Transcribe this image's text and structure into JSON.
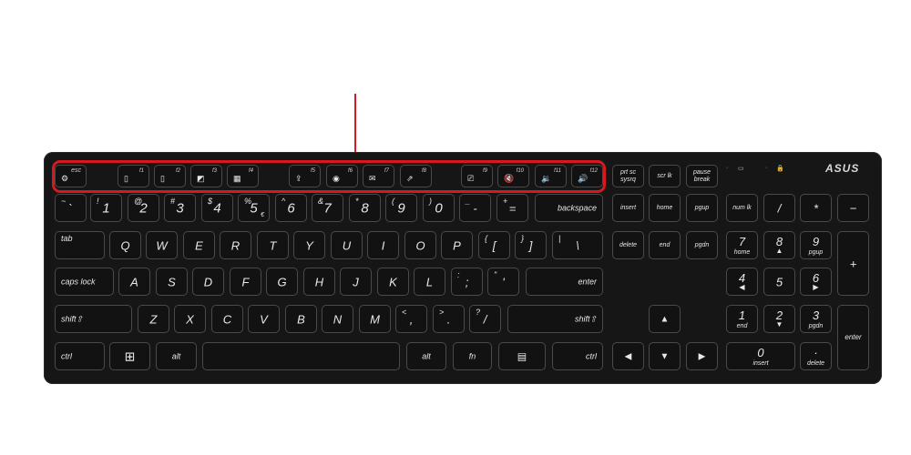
{
  "brand": {
    "logo_text": "ASUS"
  },
  "colors": {
    "highlight": "#d6191f",
    "keyboard": "#161616"
  },
  "indicators": {
    "num_led": "·",
    "battery_icon": "▭",
    "caps_led": "·",
    "lock_icon": "🔒"
  },
  "keys": {
    "esc": "esc",
    "f1": "f1",
    "f2": "f2",
    "f3": "f3",
    "f4": "f4",
    "f5": "f5",
    "f6": "f6",
    "f7": "f7",
    "f8": "f8",
    "f9": "f9",
    "f10": "f10",
    "f11": "f11",
    "f12": "f12",
    "prtsc_top": "prt sc",
    "prtsc_bottom": "sysrq",
    "scrlk": "scr lk",
    "pause_top": "pause",
    "pause_bottom": "break",
    "tilde_top": "~",
    "tilde_main": "`",
    "n1_top": "!",
    "n1": "1",
    "n2_top": "@",
    "n2": "2",
    "n3_top": "#",
    "n3": "3",
    "n4_top": "$",
    "n4": "4",
    "n4_sub": "",
    "n5_top": "%",
    "n5": "5",
    "n5_sub": "€",
    "n6_top": "^",
    "n6": "6",
    "n7_top": "&",
    "n7": "7",
    "n8_top": "*",
    "n8": "8",
    "n9_top": "(",
    "n9": "9",
    "n0_top": ")",
    "n0": "0",
    "minus_top": "_",
    "minus": "-",
    "equals_top": "+",
    "equals": "=",
    "backspace": "backspace",
    "insert": "insert",
    "home": "home",
    "pgup": "pgup",
    "numlk": "num lk",
    "np_div": "/",
    "np_mul": "*",
    "np_sub": "−",
    "tab": "tab",
    "q": "Q",
    "w": "W",
    "e": "E",
    "r": "R",
    "t": "T",
    "y": "Y",
    "u": "U",
    "i": "I",
    "o": "O",
    "p": "P",
    "lbr_top": "{",
    "lbr": "[",
    "rbr_top": "}",
    "rbr": "]",
    "bsl_top": "|",
    "bsl": "\\",
    "delete": "delete",
    "end": "end",
    "pgdn": "pgdn",
    "np7": "7",
    "np7_sub": "home",
    "np8": "8",
    "np8_sub": "▲",
    "np9": "9",
    "np9_sub": "pgup",
    "np_add": "+",
    "caps": "caps lock",
    "a": "A",
    "s": "S",
    "d": "D",
    "f": "F",
    "g": "G",
    "h": "H",
    "j": "J",
    "k": "K",
    "l": "L",
    "semi_top": ":",
    "semi": ";",
    "quote_top": "\"",
    "quote": "'",
    "enter": "enter",
    "np4": "4",
    "np4_sub": "◀",
    "np5": "5",
    "np6": "6",
    "np6_sub": "▶",
    "lshift": "shift⇧",
    "z": "Z",
    "x": "X",
    "c": "C",
    "v": "V",
    "b": "B",
    "n": "N",
    "m": "M",
    "comma_top": "<",
    "comma": ",",
    "period_top": ">",
    "period": ".",
    "slash_top": "?",
    "slash": "/",
    "rshift": "shift⇧",
    "up": "▲",
    "np1": "1",
    "np1_sub": "end",
    "np2": "2",
    "np2_sub": "▼",
    "np3": "3",
    "np3_sub": "pgdn",
    "np_enter": "enter",
    "lctrl": "ctrl",
    "win": "⊞",
    "lalt": "alt",
    "ralt": "alt",
    "fn": "fn",
    "menu": "▤",
    "rctrl": "ctrl",
    "left": "◀",
    "down": "▼",
    "right": "▶",
    "np0": "0",
    "np0_sub": "insert",
    "np_dot": "·",
    "np_dot_sub": "delete"
  },
  "icons": {
    "esc_icon": "⚙",
    "f1_icon": "▯",
    "f2_icon": "▯",
    "f3_icon": "◩",
    "f4_icon": "▦",
    "f5_icon": "⇪",
    "f6_icon": "◉",
    "f7_icon": "✉",
    "f8_icon": "⇗",
    "f9_icon": "⎚",
    "f10_icon": "🔇",
    "f11_icon": "🔉",
    "f12_icon": "🔊"
  }
}
